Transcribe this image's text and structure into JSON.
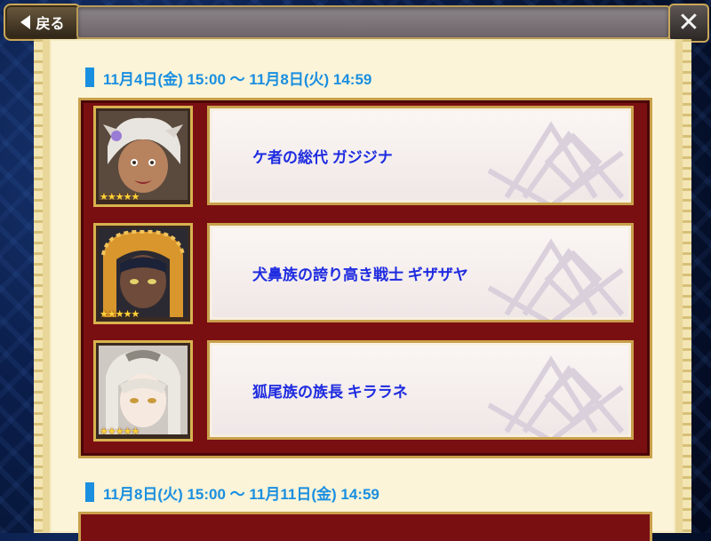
{
  "topbar": {
    "back_label": "戻る",
    "close_label": "✕"
  },
  "schedules": [
    {
      "period": "11月4日(金) 15:00 〜 11月8日(火) 14:59",
      "characters": [
        {
          "name": "ケ者の総代 ガジジナ",
          "rarity": "★★★★★",
          "portrait": "gajijina-portrait"
        },
        {
          "name": "犬鼻族の誇り高き戦士 ギザザヤ",
          "rarity": "★★★★★",
          "portrait": "gizazaya-portrait"
        },
        {
          "name": "狐尾族の族長 キララネ",
          "rarity": "★★★★★",
          "portrait": "kiralane-portrait"
        }
      ]
    },
    {
      "period": "11月8日(火) 15:00 〜 11月11日(金) 14:59",
      "characters": []
    }
  ],
  "colors": {
    "date_text": "#1a8fe0",
    "name_text": "#1e2be0",
    "frame_red": "#7a0f12",
    "gold": "#c9a04b"
  }
}
